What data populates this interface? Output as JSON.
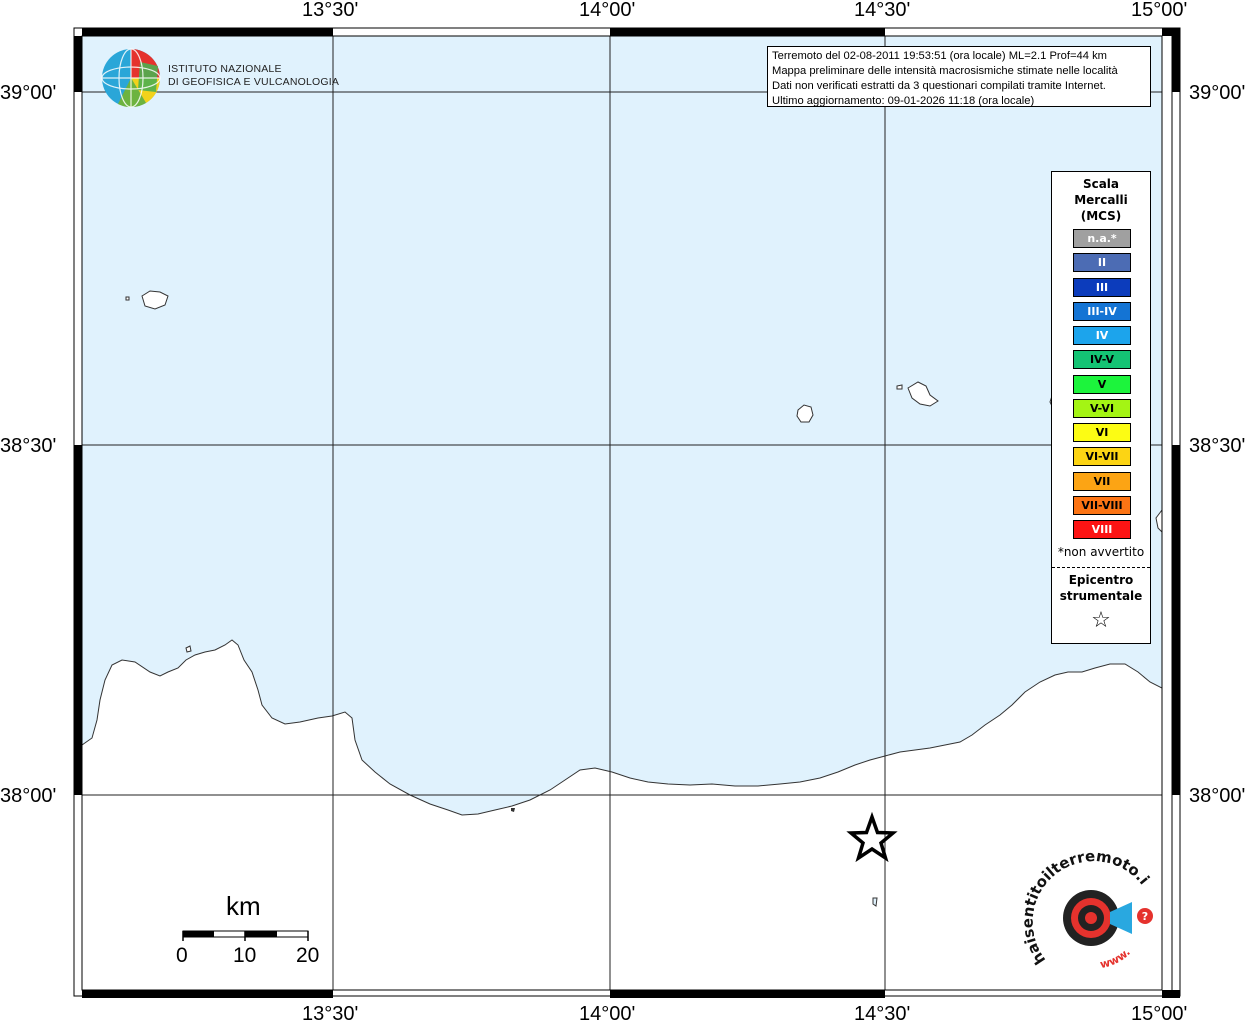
{
  "map": {
    "lon_range": [
      13.0,
      15.0
    ],
    "lat_range": [
      37.55,
      39.05
    ],
    "sea_color": "#e0f2fd",
    "land_color": "#ffffff",
    "top_labels": [
      "13°30'",
      "14°00'",
      "14°30'",
      "15°00'"
    ],
    "bottom_labels": [
      "13°30'",
      "14°00'",
      "14°30'",
      "15°00'"
    ],
    "left_labels": [
      "39°00'",
      "38°30'",
      "38°00'"
    ],
    "right_labels": [
      "39°00'",
      "38°30'",
      "38°00'"
    ]
  },
  "info": {
    "line1": "Terremoto del 02-08-2011 19:53:51 (ora locale) ML=2.1 Prof=44 km",
    "line2": "Mappa preliminare delle intensità macrosismiche stimate nelle località",
    "line3": "Dati non verificati estratti da 3 questionari compilati tramite Internet.",
    "line4": "Ultimo aggiornamento: 09-01-2026 11:18 (ora locale)"
  },
  "institute": {
    "line1": "ISTITUTO NAZIONALE",
    "line2": "DI GEOFISICA E VULCANOLOGIA"
  },
  "legend": {
    "title1": "Scala",
    "title2": "Mercalli",
    "title3": "(MCS)",
    "classes": [
      {
        "label": "n.a.*",
        "color": "#a0a0a0",
        "text": "#ffffff"
      },
      {
        "label": "II",
        "color": "#4c6cb4",
        "text": "#ffffff"
      },
      {
        "label": "III",
        "color": "#0c3cbc",
        "text": "#ffffff"
      },
      {
        "label": "III-IV",
        "color": "#1474d4",
        "text": "#ffffff"
      },
      {
        "label": "IV",
        "color": "#1ca4ec",
        "text": "#ffffff"
      },
      {
        "label": "IV-V",
        "color": "#14c474",
        "text": "#000000"
      },
      {
        "label": "V",
        "color": "#1cf43c",
        "text": "#000000"
      },
      {
        "label": "V-VI",
        "color": "#a4f414",
        "text": "#000000"
      },
      {
        "label": "VI",
        "color": "#fcfc14",
        "text": "#000000"
      },
      {
        "label": "VI-VII",
        "color": "#fcd414",
        "text": "#000000"
      },
      {
        "label": "VII",
        "color": "#fca414",
        "text": "#000000"
      },
      {
        "label": "VII-VIII",
        "color": "#fc7414",
        "text": "#000000"
      },
      {
        "label": "VIII",
        "color": "#fc1414",
        "text": "#ffffff"
      }
    ],
    "na_note": "*non avvertito",
    "epicenter_title1": "Epicentro",
    "epicenter_title2": "strumentale",
    "epicenter_symbol": "☆"
  },
  "epicenter": {
    "lon": 14.48,
    "lat": 37.93
  },
  "scale_bar": {
    "unit": "km",
    "labels": [
      "0",
      "10",
      "20"
    ]
  },
  "site_logo": {
    "text": "haisentitoilterremoto.it",
    "prefix": "www."
  }
}
